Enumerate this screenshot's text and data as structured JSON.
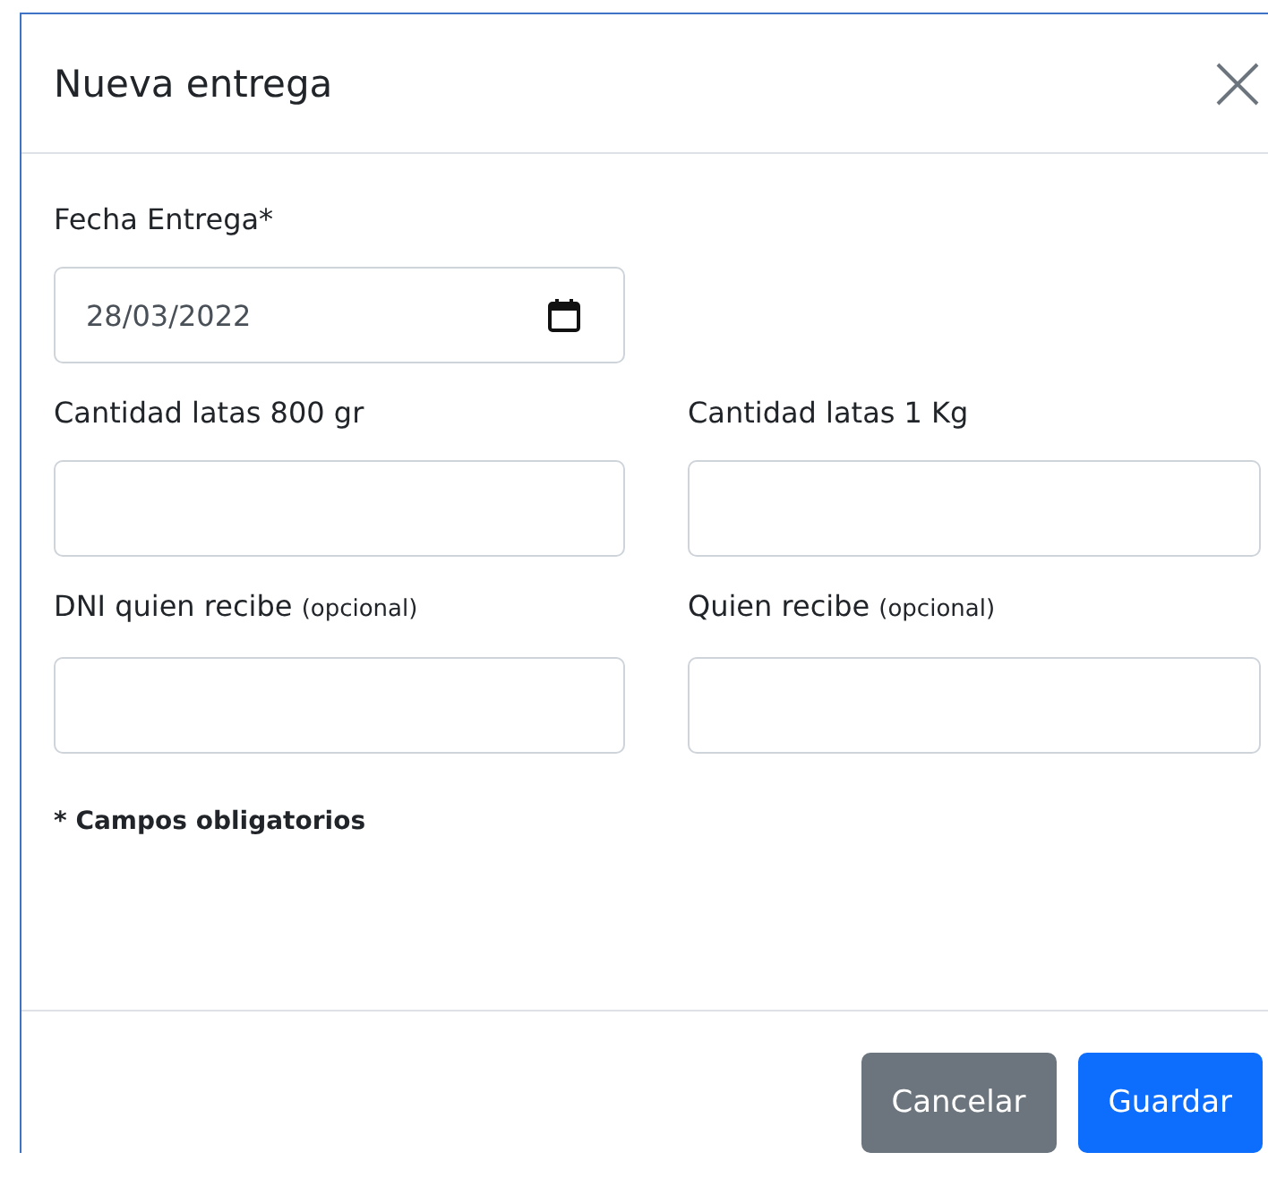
{
  "modal": {
    "title": "Nueva entrega"
  },
  "fields": [
    {
      "kind": "date",
      "label": "Fecha Entrega*",
      "value": "28/03/2022"
    },
    {
      "kind": "text",
      "label": "Cantidad latas 800 gr"
    },
    {
      "kind": "text",
      "label": "Cantidad latas 1 Kg"
    },
    {
      "kind": "text",
      "label": "DNI quien recibe",
      "hint": "(opcional)"
    },
    {
      "kind": "text",
      "label": "Quien recibe",
      "hint": "(opcional)"
    }
  ],
  "note": "* Campos obligatorios",
  "buttons": [
    {
      "kind": "secondary",
      "label": "Cancelar"
    },
    {
      "kind": "primary",
      "label": "Guardar"
    }
  ]
}
